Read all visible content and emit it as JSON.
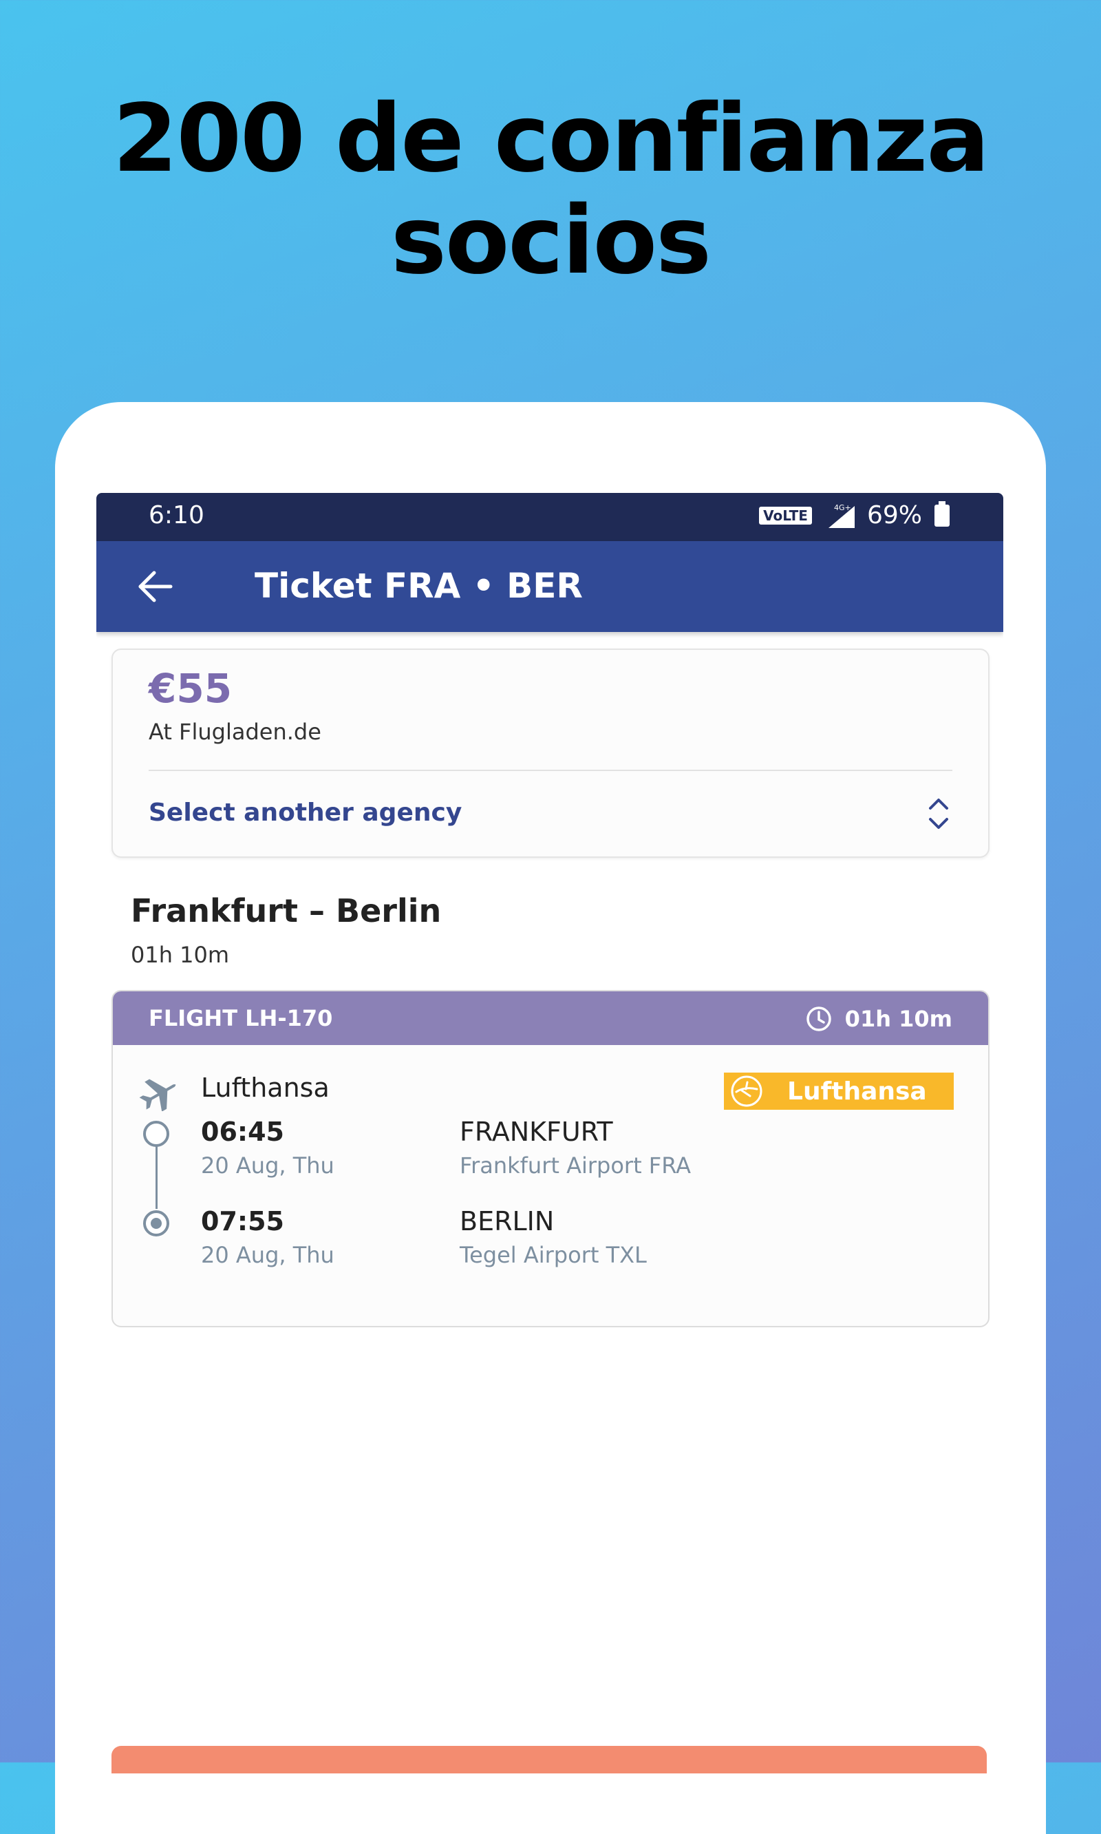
{
  "headline": {
    "line1": "200 de confianza",
    "line2": "socios"
  },
  "status_bar": {
    "time": "6:10",
    "volte": "VoLTE",
    "network": "4G+",
    "battery": "69%"
  },
  "app_bar": {
    "title": "Ticket FRA • BER"
  },
  "price_box": {
    "price": "€55",
    "agency": "At Flugladen.de",
    "select_label": "Select another agency"
  },
  "route": {
    "title": "Frankfurt – Berlin",
    "duration": "01h 10m"
  },
  "flight": {
    "number": "FLIGHT LH-170",
    "duration": "01h 10m",
    "airline": "Lufthansa",
    "logo_text": "Lufthansa",
    "departure": {
      "time": "06:45",
      "date": "20 Aug, Thu",
      "city": "FRANKFURT",
      "airport": "Frankfurt Airport FRA"
    },
    "arrival": {
      "time": "07:55",
      "date": "20 Aug, Thu",
      "city": "BERLIN",
      "airport": "Tegel Airport TXL"
    }
  },
  "colors": {
    "status_bar": "#1F2A55",
    "app_bar": "#314A96",
    "price": "#7B6BAE",
    "flight_header": "#8B81B6",
    "lufthansa_yellow": "#F9B82A",
    "bottom_button": "#F38C70"
  }
}
